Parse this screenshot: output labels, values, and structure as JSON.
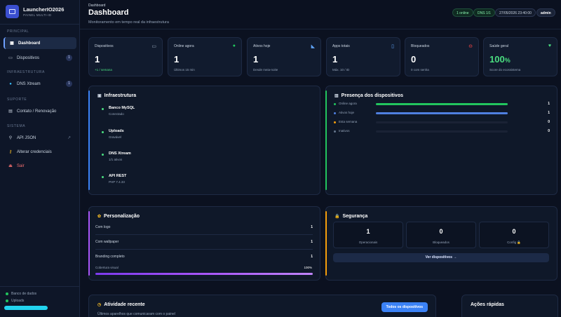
{
  "brand": {
    "name": "LauncherIO2026",
    "subtitle": "PAINEL MULTI-ID"
  },
  "sidebar": {
    "sections": [
      {
        "label": "PRINCIPAL"
      },
      {
        "label": "INFRAESTRUTURA"
      },
      {
        "label": "SUPORTE"
      },
      {
        "label": "SISTEMA"
      }
    ],
    "items": [
      {
        "label": "Dashboard",
        "icon": "dashboard-icon"
      },
      {
        "label": "Dispositivos",
        "badge": "1",
        "icon": "devices-icon"
      },
      {
        "label": "DNS Xtream",
        "badge": "1",
        "icon": "globe-icon"
      },
      {
        "label": "Contato / Renovação",
        "icon": "chat-icon"
      },
      {
        "label": "API JSON",
        "icon": "plug-icon"
      },
      {
        "label": "Alterar credenciais",
        "icon": "key-icon"
      },
      {
        "label": "Sair",
        "icon": "logout-icon"
      }
    ],
    "status": [
      {
        "label": "Banco de dados",
        "color": "#22c55e"
      },
      {
        "label": "Uploads",
        "color": "#22c55e"
      }
    ]
  },
  "header": {
    "breadcrumb": "Dashboard",
    "title": "Dashboard",
    "subtitle": "Monitoramento em tempo real da infraestrutura",
    "online_pill": "1 online",
    "dns_pill": "DNS 1/1",
    "datetime": "27/05/2026 23:40:00",
    "user": "admin"
  },
  "stats": [
    {
      "label": "Dispositivos",
      "value": "1",
      "note": "+1 / semana",
      "icon": "monitor-icon"
    },
    {
      "label": "Online agora",
      "value": "1",
      "note": "Últimos 15 min",
      "icon": "green-dot-icon"
    },
    {
      "label": "Ativos hoje",
      "value": "1",
      "note": "Desde meia-noite",
      "icon": "chart-icon"
    },
    {
      "label": "Apps totais",
      "value": "1",
      "note": "Máx. 10 / ID",
      "icon": "phone-icon"
    },
    {
      "label": "Bloqueados",
      "value": "0",
      "note": "0 com senha",
      "icon": "blocked-icon"
    },
    {
      "label": "Saúde geral",
      "value": "100",
      "value_suffix": "%",
      "note": "Score do ecossistema",
      "icon": "heart-icon"
    }
  ],
  "infra": {
    "title": "Infraestrutura",
    "items": [
      {
        "name": "Banco MySQL",
        "status": "Conectado"
      },
      {
        "name": "Uploads",
        "status": "Gravável"
      },
      {
        "name": "DNS Xtream",
        "status": "1/1 ativos"
      },
      {
        "name": "API REST",
        "status": "PHP 7.4.33"
      }
    ]
  },
  "presence": {
    "title": "Presença dos dispositivos",
    "rows": [
      {
        "label": "Online agora",
        "value": "1",
        "fraction": 1.0,
        "color": "#22c55e"
      },
      {
        "label": "Ativos hoje",
        "value": "1",
        "fraction": 1.0,
        "color": "#4f7fe0"
      },
      {
        "label": "Esta semana",
        "value": "0",
        "fraction": 0,
        "color": "#f59e0b"
      },
      {
        "label": "Inativos",
        "value": "0",
        "fraction": 0,
        "color": "#64748b"
      }
    ]
  },
  "personalization": {
    "title": "Personalização",
    "rows": [
      {
        "label": "Com logo",
        "value": "1"
      },
      {
        "label": "Com wallpaper",
        "value": "1"
      },
      {
        "label": "Branding completo",
        "value": "1"
      }
    ],
    "coverage_label": "Cobertura visual",
    "coverage_value": "100%",
    "coverage_fraction": 1.0
  },
  "security": {
    "title": "Segurança",
    "boxes": [
      {
        "value": "1",
        "label": "Operacionais"
      },
      {
        "value": "0",
        "label": "Bloqueados"
      },
      {
        "value": "0",
        "label": "Config 🔒"
      }
    ],
    "button": "Ver dispositivos →"
  },
  "activity": {
    "title": "Atividade recente",
    "subtitle": "Últimos aparelhos que comunicaram com o painel",
    "button": "Todos os dispositivos"
  },
  "quick_actions": {
    "title": "Ações rápidas"
  }
}
